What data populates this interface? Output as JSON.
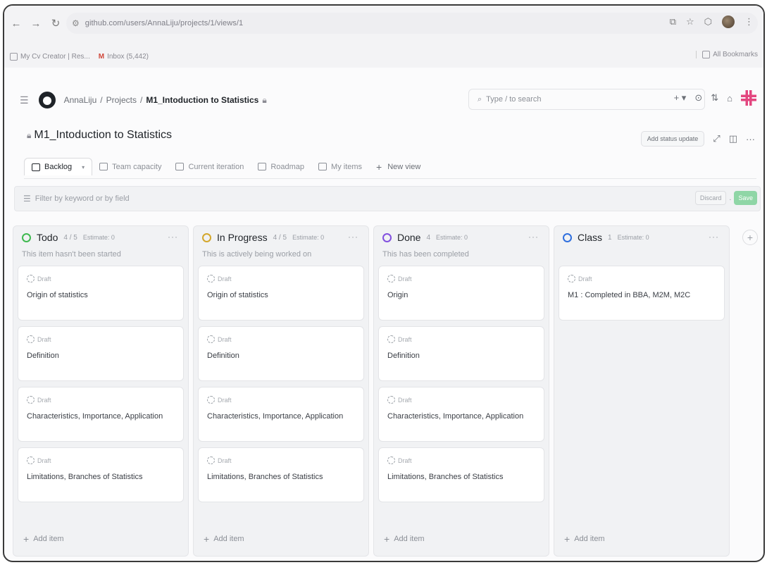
{
  "browser": {
    "url": "github.com/users/AnnaLiju/projects/1/views/1",
    "bookmarks": [
      "My Cv Creator | Res...",
      "Inbox (5,442)"
    ],
    "all_bookmarks": "All Bookmarks"
  },
  "header": {
    "breadcrumb": [
      "AnnaLiju",
      "Projects",
      "M1_Intoduction to Statistics"
    ],
    "search_placeholder": "Type / to search"
  },
  "project": {
    "title": "M1_Intoduction to Statistics",
    "add_status_update": "Add status update"
  },
  "tabs": [
    {
      "label": "Backlog",
      "active": true
    },
    {
      "label": "Team capacity"
    },
    {
      "label": "Current iteration"
    },
    {
      "label": "Roadmap"
    },
    {
      "label": "My items"
    },
    {
      "label": "New view"
    }
  ],
  "filter": {
    "placeholder": "Filter by keyword or by field",
    "discard": "Discard",
    "save": "Save"
  },
  "columns": [
    {
      "name": "Todo",
      "count": "4 / 5",
      "estimate": "Estimate: 0",
      "color": "#3fb950",
      "description": "This item hasn't been started",
      "cards": [
        {
          "status": "Draft",
          "title": "Origin of statistics"
        },
        {
          "status": "Draft",
          "title": "Definition"
        },
        {
          "status": "Draft",
          "title": "Characteristics, Importance, Application"
        },
        {
          "status": "Draft",
          "title": "Limitations, Branches of Statistics"
        }
      ],
      "add_item": "Add item"
    },
    {
      "name": "In Progress",
      "count": "4 / 5",
      "estimate": "Estimate: 0",
      "color": "#d4a72c",
      "description": "This is actively being worked on",
      "cards": [
        {
          "status": "Draft",
          "title": "Origin of statistics"
        },
        {
          "status": "Draft",
          "title": "Definition"
        },
        {
          "status": "Draft",
          "title": "Characteristics, Importance, Application"
        },
        {
          "status": "Draft",
          "title": "Limitations, Branches of Statistics"
        }
      ],
      "add_item": "Add item"
    },
    {
      "name": "Done",
      "count": "4",
      "estimate": "Estimate: 0",
      "color": "#8250df",
      "description": "This has been completed",
      "cards": [
        {
          "status": "Draft",
          "title": "Origin"
        },
        {
          "status": "Draft",
          "title": "Definition"
        },
        {
          "status": "Draft",
          "title": "Characteristics, Importance, Application"
        },
        {
          "status": "Draft",
          "title": "Limitations, Branches of Statistics"
        }
      ],
      "add_item": "Add item"
    },
    {
      "name": "Class",
      "count": "1",
      "estimate": "Estimate: 0",
      "color": "#2f6fde",
      "description": "",
      "cards": [
        {
          "status": "Draft",
          "title": "M1 : Completed in BBA, M2M, M2C"
        }
      ],
      "add_item": "Add item"
    }
  ]
}
